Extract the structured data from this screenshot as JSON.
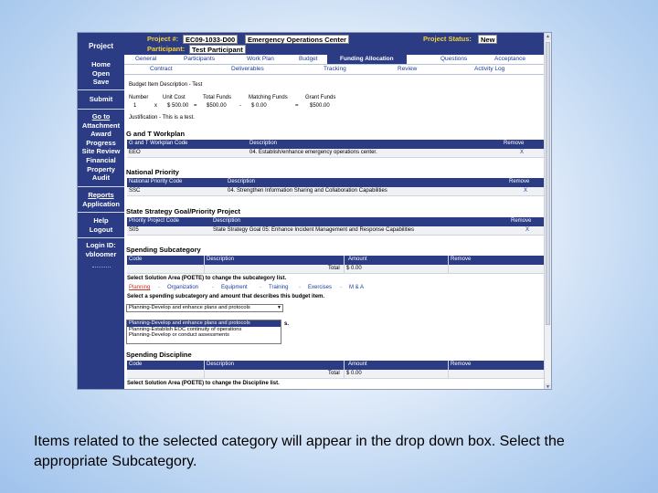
{
  "nav": {
    "title": "Project",
    "group1": [
      "Home",
      "Open",
      "Save"
    ],
    "submit": "Submit",
    "group2": [
      "Go to",
      "Attachment",
      "Award",
      "Progress",
      "Site Review",
      "Financial",
      "Property",
      "Audit"
    ],
    "reports": [
      "Reports",
      "Application"
    ],
    "help": [
      "Help",
      "Logout"
    ],
    "login_label": "Login ID:",
    "login_value": "vbloomer"
  },
  "header": {
    "project_label": "Project #:",
    "project_number": "EC09-1033-D00",
    "project_name": "Emergency Operations Center",
    "status_label": "Project Status:",
    "status_value": "New",
    "participant_label": "Participant:",
    "participant_value": "Test Participant"
  },
  "tabs_row1": [
    "General",
    "Participants",
    "Work Plan",
    "Budget",
    "Funding Allocation",
    "Questions",
    "Acceptance"
  ],
  "tabs_row1_active": "Funding Allocation",
  "tabs_row2": [
    "Contract",
    "Deliverables",
    "Tracking",
    "Review",
    "Activity Log"
  ],
  "budget": {
    "description": "Budget Item Description - Test",
    "headers": [
      "Number",
      "Unit Cost",
      "Total Funds",
      "Matching Funds",
      "Grant Funds"
    ],
    "values": [
      "1",
      "x",
      "$ 500.00",
      "=",
      "$500.00",
      "-",
      "$ 0.00",
      "=",
      "$500.00"
    ],
    "justification": "Justification - This is a test."
  },
  "workplan": {
    "title": "G and T Workplan",
    "headers": [
      "G and T Workplan Code",
      "Description",
      "Remove"
    ],
    "row": [
      "EEO",
      "04. Establish/enhance emergency operations center.",
      "X"
    ]
  },
  "national_priority": {
    "title": "National Priority",
    "headers": [
      "National Priority Code",
      "Description",
      "Remove"
    ],
    "row": [
      "SSC",
      "04. Strengthen Information Sharing and Collaboration Capabilities",
      "X"
    ]
  },
  "state_strategy": {
    "title": "State Strategy Goal/Priority Project",
    "headers": [
      "Priority Project Code",
      "Description",
      "Remove"
    ],
    "row": [
      "S05",
      "State Strategy Goal 05: Enhance Incident Management and Response Capabilities",
      "X"
    ]
  },
  "spending_subcategory": {
    "title": "Spending Subcategory",
    "headers": [
      "Code",
      "Description",
      "Amount",
      "Remove"
    ],
    "total_label": "Total",
    "total_value": "$ 0.00",
    "select_area": "Select Solution Area (POETE) to change the subcategory list.",
    "areas": [
      "Planning",
      "Organization",
      "Equipment",
      "Training",
      "Exercises",
      "M & A"
    ],
    "select_prompt": "Select a spending subcategory and amount that describes this budget item.",
    "dropdown_value": "Planning-Develop and enhance plans and protocols",
    "dropdown_options": [
      "Planning-Develop and enhance plans and protocols",
      "Planning-Develop and enhance plans and protocols",
      "Planning-Establish EOC continuity of operations",
      "Planning-Develop or conduct assessments"
    ],
    "dropdown_selected_index": 1,
    "trailing_text": "s."
  },
  "spending_discipline": {
    "title": "Spending Discipline",
    "headers": [
      "Code",
      "Description",
      "Amount",
      "Remove"
    ],
    "total_label": "Total",
    "total_value": "$ 0.00",
    "select_area": "Select Solution Area (POETE) to change the Discipline list."
  },
  "caption": "Items related to the selected category will appear in the drop down box.  Select the appropriate Subcategory.",
  "colors": {
    "nav_bg": "#2b3c84",
    "header_label": "#f2cf3a",
    "link": "#1b3b9a",
    "planning_link": "#c0392b",
    "row_bg": "#eff1f5"
  }
}
